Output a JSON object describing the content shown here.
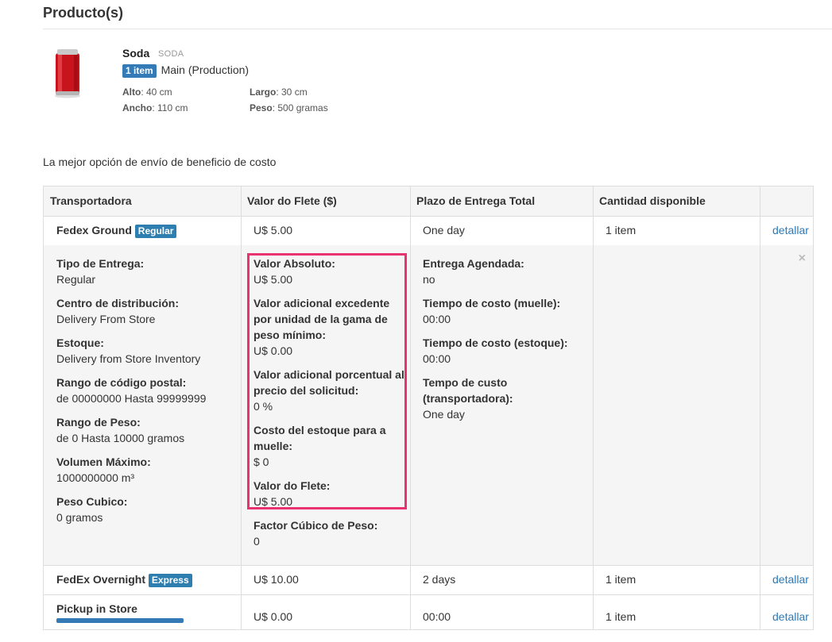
{
  "section_title": "Producto(s)",
  "product": {
    "name": "Soda",
    "sku": "SODA",
    "stock_badge": "1 item",
    "warehouse": "Main (Production)",
    "alto_label": "Alto",
    "alto_value": ": 40 cm",
    "ancho_label": "Ancho",
    "ancho_value": ": 110 cm",
    "largo_label": "Largo",
    "largo_value": ": 30 cm",
    "peso_label": "Peso",
    "peso_value": ": 500 gramas"
  },
  "intro_text": "La mejor opción de envío de beneficio de costo",
  "table": {
    "headers": [
      "Transportadora",
      "Valor do Flete ($)",
      "Plazo de Entrega Total",
      "Cantidad disponible"
    ],
    "rows": [
      {
        "carrier": "Fedex Ground",
        "badge": "Regular",
        "value": "U$ 5.00",
        "time": "One day",
        "qty": "1 item",
        "action": "detallar"
      },
      {
        "carrier": "FedEx Overnight",
        "badge": "Express",
        "value": "U$ 10.00",
        "time": "2 days",
        "qty": "1 item",
        "action": "detallar"
      },
      {
        "carrier": "Pickup in Store",
        "badge": "",
        "value": "U$ 0.00",
        "time": "00:00",
        "qty": "1 item",
        "action": "detallar"
      }
    ],
    "detail": {
      "col1": [
        {
          "label": "Tipo de Entrega:",
          "value": "Regular"
        },
        {
          "label": "Centro de distribución:",
          "value": "Delivery From Store"
        },
        {
          "label": "Estoque:",
          "value": "Delivery from Store Inventory"
        },
        {
          "label": "Rango de código postal:",
          "value": "de 00000000 Hasta 99999999"
        },
        {
          "label": "Rango de Peso:",
          "value": "de 0 Hasta 10000 gramos"
        },
        {
          "label": "Volumen Máximo:",
          "value": "1000000000 m³"
        },
        {
          "label": "Peso Cubico:",
          "value": "0 gramos"
        }
      ],
      "col2": [
        {
          "label": "Valor Absoluto:",
          "value": "U$ 5.00"
        },
        {
          "label": "Valor adicional excedente por unidad de la gama de peso mínimo:",
          "value": "U$ 0.00"
        },
        {
          "label": "Valor adicional porcentual al precio del solicitud:",
          "value": "0 %"
        },
        {
          "label": "Costo del estoque para a muelle:",
          "value": "$ 0"
        },
        {
          "label": "Valor do Flete:",
          "value": "U$ 5.00"
        },
        {
          "label": "Factor Cúbico de Peso:",
          "value": "0"
        }
      ],
      "col3": [
        {
          "label": "Entrega Agendada:",
          "value": "no"
        },
        {
          "label": "Tiempo de costo (muelle):",
          "value": "00:00"
        },
        {
          "label": "Tiempo de costo (estoque):",
          "value": "00:00"
        },
        {
          "label": "Tempo de custo (transportadora):",
          "value": "One day"
        }
      ],
      "close_icon": "×"
    }
  },
  "colors": {
    "badge": "#337ab7",
    "link": "#2a7ab8",
    "highlight": "#e8336e"
  }
}
